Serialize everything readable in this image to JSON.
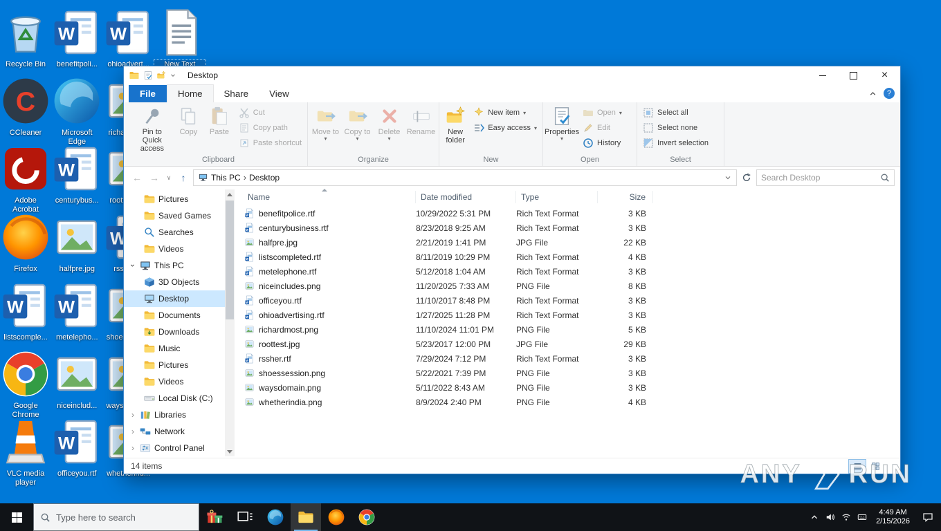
{
  "desktop": {
    "icons": [
      {
        "dn": "desktop-icon-recycle-bin",
        "label": "Recycle Bin",
        "icon": "recycle",
        "col": 0,
        "row": 0
      },
      {
        "dn": "desktop-icon-benefitpolice",
        "label": "benefitpoli...",
        "icon": "word",
        "col": 1,
        "row": 0
      },
      {
        "dn": "desktop-icon-ohioadvertising",
        "label": "ohioadvert...",
        "icon": "word",
        "col": 2,
        "row": 0
      },
      {
        "dn": "desktop-icon-new-text-document",
        "label": "New Text Document....",
        "icon": "textdoc",
        "col": 3,
        "row": 0,
        "selected": true
      },
      {
        "dn": "desktop-icon-ccleaner",
        "label": "CCleaner",
        "icon": "ccleaner",
        "col": 0,
        "row": 1
      },
      {
        "dn": "desktop-icon-microsoft-edge",
        "label": "Microsoft Edge",
        "icon": "edge",
        "col": 1,
        "row": 1
      },
      {
        "dn": "desktop-icon-richardmost",
        "label": "richardmo...",
        "icon": "image",
        "col": 2,
        "row": 1
      },
      {
        "dn": "desktop-icon-adobe-acrobat",
        "label": "Adobe Acrobat",
        "icon": "acrobat",
        "col": 0,
        "row": 2
      },
      {
        "dn": "desktop-icon-centurybusiness",
        "label": "centurybus...",
        "icon": "word",
        "col": 1,
        "row": 2
      },
      {
        "dn": "desktop-icon-roottest",
        "label": "roottest.jpg",
        "icon": "image",
        "col": 2,
        "row": 2
      },
      {
        "dn": "desktop-icon-firefox",
        "label": "Firefox",
        "icon": "firefox",
        "col": 0,
        "row": 3
      },
      {
        "dn": "desktop-icon-halfpre",
        "label": "halfpre.jpg",
        "icon": "image",
        "col": 1,
        "row": 3
      },
      {
        "dn": "desktop-icon-rssher",
        "label": "rssher.rtf",
        "icon": "word",
        "col": 2,
        "row": 3
      },
      {
        "dn": "desktop-icon-listscompleted",
        "label": "listscomple...",
        "icon": "word",
        "col": 0,
        "row": 4
      },
      {
        "dn": "desktop-icon-metelephone",
        "label": "metelepho...",
        "icon": "word",
        "col": 1,
        "row": 4
      },
      {
        "dn": "desktop-icon-shoessession",
        "label": "shoessessi...",
        "icon": "image",
        "col": 2,
        "row": 4
      },
      {
        "dn": "desktop-icon-google-chrome",
        "label": "Google Chrome",
        "icon": "chrome",
        "col": 0,
        "row": 5
      },
      {
        "dn": "desktop-icon-niceincludes",
        "label": "niceinclud...",
        "icon": "image",
        "col": 1,
        "row": 5
      },
      {
        "dn": "desktop-icon-waysdomain",
        "label": "waysdomai...",
        "icon": "image",
        "col": 2,
        "row": 5
      },
      {
        "dn": "desktop-icon-vlc",
        "label": "VLC media player",
        "icon": "vlc",
        "col": 0,
        "row": 6
      },
      {
        "dn": "desktop-icon-officeyou",
        "label": "officeyou.rtf",
        "icon": "word",
        "col": 1,
        "row": 6
      },
      {
        "dn": "desktop-icon-whetherindia",
        "label": "whetherind...",
        "icon": "image",
        "col": 2,
        "row": 6
      }
    ]
  },
  "explorer": {
    "title": "Desktop",
    "tabs": {
      "file": "File",
      "home": "Home",
      "share": "Share",
      "view": "View"
    },
    "ribbon": {
      "clipboard": {
        "label": "Clipboard",
        "pin": "Pin to Quick access",
        "copy": "Copy",
        "paste": "Paste",
        "cut": "Cut",
        "copy_path": "Copy path",
        "paste_shortcut": "Paste shortcut"
      },
      "organize": {
        "label": "Organize",
        "move_to": "Move to",
        "copy_to": "Copy to",
        "delete": "Delete",
        "rename": "Rename"
      },
      "new_group": {
        "label": "New",
        "new_folder": "New folder",
        "new_item": "New item",
        "easy_access": "Easy access"
      },
      "open_group": {
        "label": "Open",
        "properties": "Properties",
        "open": "Open",
        "edit": "Edit",
        "history": "History"
      },
      "select_group": {
        "label": "Select",
        "select_all": "Select all",
        "select_none": "Select none",
        "invert": "Invert selection"
      }
    },
    "address": {
      "root": "This PC",
      "current": "Desktop",
      "search_placeholder": "Search Desktop"
    },
    "nav": [
      {
        "dn": "sidebar-item-pictures",
        "label": "Pictures",
        "icon": "folder",
        "indent": 2
      },
      {
        "dn": "sidebar-item-saved-games",
        "label": "Saved Games",
        "icon": "folder",
        "indent": 2
      },
      {
        "dn": "sidebar-item-searches",
        "label": "Searches",
        "icon": "searches",
        "indent": 2
      },
      {
        "dn": "sidebar-item-videos",
        "label": "Videos",
        "icon": "folder",
        "indent": 2
      },
      {
        "dn": "sidebar-item-this-pc",
        "label": "This PC",
        "icon": "pc",
        "indent": 1,
        "exp": "open"
      },
      {
        "dn": "sidebar-item-3d-objects",
        "label": "3D Objects",
        "icon": "cube",
        "indent": 2
      },
      {
        "dn": "sidebar-item-desktop",
        "label": "Desktop",
        "icon": "desknav",
        "indent": 2,
        "selected": true
      },
      {
        "dn": "sidebar-item-documents",
        "label": "Documents",
        "icon": "folder",
        "indent": 2
      },
      {
        "dn": "sidebar-item-downloads",
        "label": "Downloads",
        "icon": "downloads",
        "indent": 2
      },
      {
        "dn": "sidebar-item-music",
        "label": "Music",
        "icon": "folder",
        "indent": 2
      },
      {
        "dn": "sidebar-item-pictures-2",
        "label": "Pictures",
        "icon": "folder",
        "indent": 2
      },
      {
        "dn": "sidebar-item-videos-2",
        "label": "Videos",
        "icon": "folder",
        "indent": 2
      },
      {
        "dn": "sidebar-item-local-disk-c",
        "label": "Local Disk (C:)",
        "icon": "disk",
        "indent": 2
      },
      {
        "dn": "sidebar-item-libraries",
        "label": "Libraries",
        "icon": "libraries",
        "indent": 1,
        "exp": "closed"
      },
      {
        "dn": "sidebar-item-network",
        "label": "Network",
        "icon": "network",
        "indent": 1,
        "exp": "closed"
      },
      {
        "dn": "sidebar-item-control-panel",
        "label": "Control Panel",
        "icon": "cpanel",
        "indent": 1,
        "exp": "closed"
      }
    ],
    "columns": {
      "name": "Name",
      "date": "Date modified",
      "type": "Type",
      "size": "Size"
    },
    "files": [
      {
        "dn": "file-row-benefitpolice",
        "name": "benefitpolice.rtf",
        "date": "10/29/2022 5:31 PM",
        "type": "Rich Text Format",
        "size": "3 KB",
        "icon": "wordfile"
      },
      {
        "dn": "file-row-centurybusiness",
        "name": "centurybusiness.rtf",
        "date": "8/23/2018 9:25 AM",
        "type": "Rich Text Format",
        "size": "3 KB",
        "icon": "wordfile"
      },
      {
        "dn": "file-row-halfpre",
        "name": "halfpre.jpg",
        "date": "2/21/2019 1:41 PM",
        "type": "JPG File",
        "size": "22 KB",
        "icon": "image"
      },
      {
        "dn": "file-row-listscompleted",
        "name": "listscompleted.rtf",
        "date": "8/11/2019 10:29 PM",
        "type": "Rich Text Format",
        "size": "4 KB",
        "icon": "wordfile"
      },
      {
        "dn": "file-row-metelephone",
        "name": "metelephone.rtf",
        "date": "5/12/2018 1:04 AM",
        "type": "Rich Text Format",
        "size": "3 KB",
        "icon": "wordfile"
      },
      {
        "dn": "file-row-niceincludes",
        "name": "niceincludes.png",
        "date": "11/20/2025 7:33 AM",
        "type": "PNG File",
        "size": "8 KB",
        "icon": "image"
      },
      {
        "dn": "file-row-officeyou",
        "name": "officeyou.rtf",
        "date": "11/10/2017 8:48 PM",
        "type": "Rich Text Format",
        "size": "3 KB",
        "icon": "wordfile"
      },
      {
        "dn": "file-row-ohioadvertising",
        "name": "ohioadvertising.rtf",
        "date": "1/27/2025 11:28 PM",
        "type": "Rich Text Format",
        "size": "3 KB",
        "icon": "wordfile"
      },
      {
        "dn": "file-row-richardmost",
        "name": "richardmost.png",
        "date": "11/10/2024 11:01 PM",
        "type": "PNG File",
        "size": "5 KB",
        "icon": "image"
      },
      {
        "dn": "file-row-roottest",
        "name": "roottest.jpg",
        "date": "5/23/2017 12:00 PM",
        "type": "JPG File",
        "size": "29 KB",
        "icon": "image"
      },
      {
        "dn": "file-row-rssher",
        "name": "rssher.rtf",
        "date": "7/29/2024 7:12 PM",
        "type": "Rich Text Format",
        "size": "3 KB",
        "icon": "wordfile"
      },
      {
        "dn": "file-row-shoessession",
        "name": "shoessession.png",
        "date": "5/22/2021 7:39 PM",
        "type": "PNG File",
        "size": "3 KB",
        "icon": "image"
      },
      {
        "dn": "file-row-waysdomain",
        "name": "waysdomain.png",
        "date": "5/11/2022 8:43 AM",
        "type": "PNG File",
        "size": "3 KB",
        "icon": "image"
      },
      {
        "dn": "file-row-whetherindia",
        "name": "whetherindia.png",
        "date": "8/9/2024 2:40 PM",
        "type": "PNG File",
        "size": "4 KB",
        "icon": "image"
      }
    ],
    "status": "14 items"
  },
  "taskbar": {
    "search_placeholder": "Type here to search",
    "apps": [
      {
        "dn": "taskbar-gift-button",
        "icon": "gift"
      },
      {
        "dn": "taskbar-taskview-button",
        "icon": "taskview"
      },
      {
        "dn": "taskbar-edge-button",
        "icon": "edge"
      },
      {
        "dn": "taskbar-explorer-button",
        "icon": "folder",
        "active": true
      },
      {
        "dn": "taskbar-firefox-button",
        "icon": "firefox"
      },
      {
        "dn": "taskbar-chrome-button",
        "icon": "chrome"
      }
    ],
    "tray": [
      {
        "dn": "tray-chevron-up-icon",
        "icon": "chevup"
      },
      {
        "dn": "tray-volume-icon",
        "icon": "volume"
      },
      {
        "dn": "tray-network-icon",
        "icon": "wifi"
      },
      {
        "dn": "tray-keyboard-icon",
        "icon": "kbd"
      }
    ],
    "time": "4:49 AM",
    "date": "2/15/2026"
  },
  "watermark": {
    "any": "ANY",
    "run": "RUN"
  }
}
